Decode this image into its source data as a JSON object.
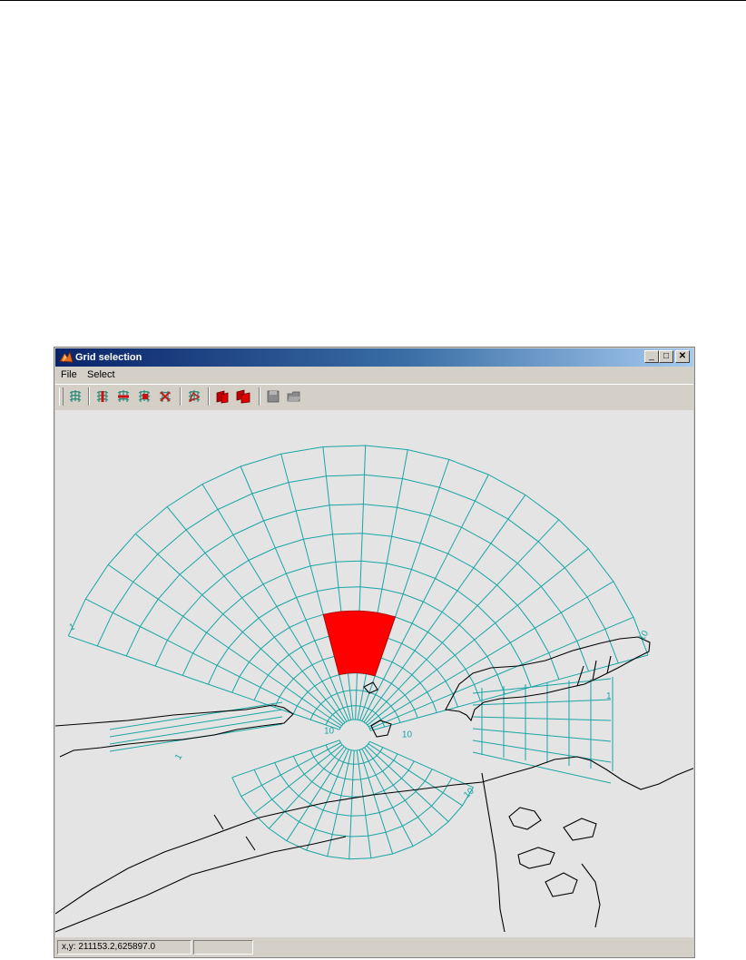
{
  "window": {
    "title": "Grid selection",
    "minimize_symbol": "_",
    "maximize_symbol": "□",
    "close_symbol": "✕"
  },
  "menu": {
    "items": [
      {
        "label": "File"
      },
      {
        "label": "Select"
      }
    ]
  },
  "toolbar": {
    "tools": [
      {
        "icon": "select-grid-icon"
      },
      {
        "icon": "select-column-icon"
      },
      {
        "icon": "select-row-icon"
      },
      {
        "icon": "select-area-icon"
      },
      {
        "icon": "deselect-icon"
      },
      {
        "icon": "select-polygon-icon"
      },
      {
        "icon": "fill-cells-icon"
      },
      {
        "icon": "fill-all-icon"
      },
      {
        "icon": "save-disabled-icon"
      },
      {
        "icon": "open-disabled-icon"
      }
    ]
  },
  "map": {
    "depth_labels": [
      "10",
      "10",
      "10",
      "10",
      "1",
      "1",
      "1"
    ],
    "grid_color": "#1aa5a5",
    "selection_color": "#ff0000",
    "coastline_color": "#000000",
    "background_color": "#e4e4e4"
  },
  "status": {
    "coordinates": "x,y: 211153.2,625897.0",
    "secondary": ""
  }
}
